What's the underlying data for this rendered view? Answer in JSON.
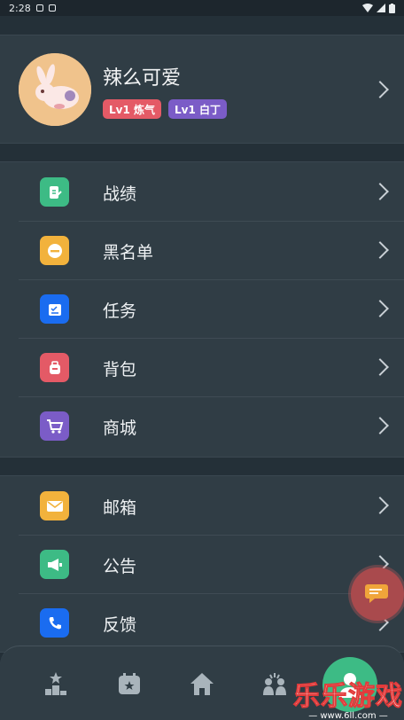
{
  "status_bar": {
    "time": "2:28"
  },
  "profile": {
    "username": "辣么可爱",
    "badges": [
      {
        "label": "Lv1 炼气",
        "color": "#e45a66"
      },
      {
        "label": "Lv1 白丁",
        "color": "#7b5cc7"
      }
    ]
  },
  "menu_groups": [
    {
      "items": [
        {
          "label": "战绩",
          "icon": "record-icon",
          "icon_color": "#3dbb85"
        },
        {
          "label": "黑名单",
          "icon": "blacklist-icon",
          "icon_color": "#f2b23c"
        },
        {
          "label": "任务",
          "icon": "task-icon",
          "icon_color": "#1a6cf0"
        },
        {
          "label": "背包",
          "icon": "backpack-icon",
          "icon_color": "#e45a66"
        },
        {
          "label": "商城",
          "icon": "cart-icon",
          "icon_color": "#7b5cc7"
        }
      ]
    },
    {
      "items": [
        {
          "label": "邮箱",
          "icon": "mail-icon",
          "icon_color": "#f2b23c"
        },
        {
          "label": "公告",
          "icon": "megaphone-icon",
          "icon_color": "#3dbb85"
        },
        {
          "label": "反馈",
          "icon": "phone-icon",
          "icon_color": "#1a6cf0"
        }
      ]
    }
  ],
  "watermark": {
    "title": "乐乐游戏",
    "url": "— www.6ll.com —"
  }
}
